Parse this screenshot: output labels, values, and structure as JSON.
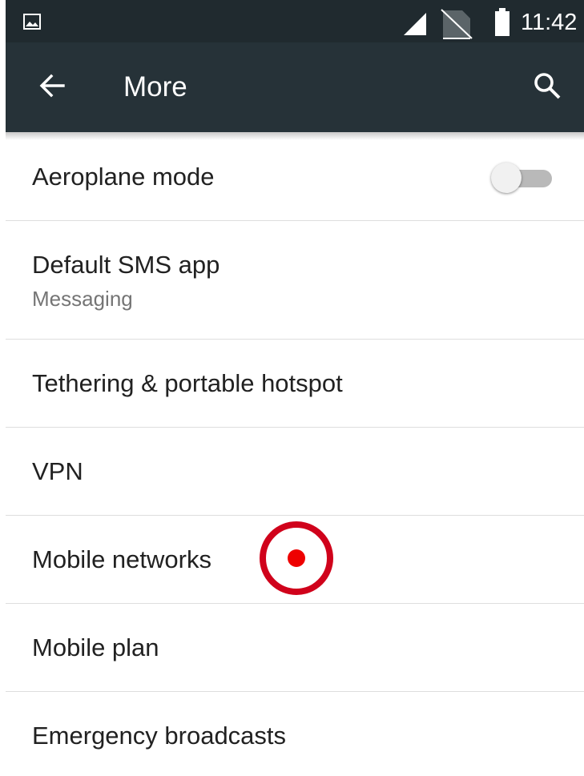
{
  "status_bar": {
    "time": "11:42",
    "icons": [
      "photo-notification-icon",
      "signal-icon",
      "no-sim-icon",
      "battery-icon"
    ]
  },
  "toolbar": {
    "title": "More",
    "back_icon": "arrow-back-icon",
    "search_icon": "search-icon",
    "background": "#263238"
  },
  "settings": {
    "aeroplane": {
      "label": "Aeroplane mode",
      "enabled": false
    },
    "sms": {
      "label": "Default SMS app",
      "summary": "Messaging"
    },
    "tethering": {
      "label": "Tethering & portable hotspot"
    },
    "vpn": {
      "label": "VPN"
    },
    "mobile_networks": {
      "label": "Mobile networks"
    },
    "mobile_plan": {
      "label": "Mobile plan"
    },
    "emergency": {
      "label": "Emergency broadcasts"
    }
  },
  "colors": {
    "status_bar": "#202a2f",
    "primary_text": "#212121",
    "secondary_text": "#757575",
    "tap_marker": "#d0021b"
  }
}
